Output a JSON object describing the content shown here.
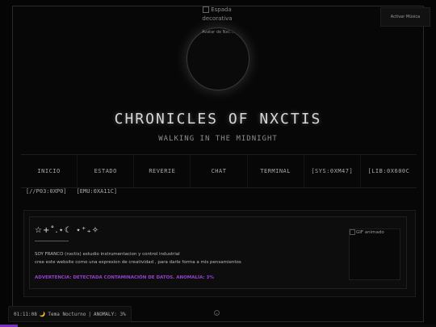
{
  "header": {
    "decorative_image_alt": "Espada decorativa",
    "music_button": "Activar Música",
    "avatar_alt": "Avatar de Nxc...",
    "title": "CHRONICLES OF NXCTIS",
    "subtitle": "WALKING IN THE MIDNIGHT"
  },
  "nav": {
    "items": [
      {
        "label": "INICIO"
      },
      {
        "label": "ESTADO"
      },
      {
        "label": "REVERIE"
      },
      {
        "label": "CHAT"
      },
      {
        "label": "TERMINAL"
      },
      {
        "label": "[SYS:0XM47]"
      },
      {
        "label": "[LIB:0X600C"
      }
    ],
    "row2": [
      {
        "label": "[//P03:0XP0]"
      },
      {
        "label": "[EMU:0XA11C]"
      }
    ]
  },
  "profile": {
    "sparkles": "☆+˚.⋆☾ ⋆⁺₊✧",
    "bio_line1": "SOY FRANCO (nxctis) estudio instrumentacion y control industrial",
    "bio_line2": "cree este website como una expresion de creatividad , para darle forma a mis pensamientos",
    "warning": "ADVERTENCIA: DETECTADA CONTAMINACIÓN DE DATOS. ANOMALÍA: 3%",
    "gif_alt": "GIF animado"
  },
  "statusbar": {
    "time": "01:11:08",
    "moon": "🌙",
    "theme": "Tema Nocturno",
    "sep": "|",
    "anomaly": "ANOMALY: 3%"
  },
  "progress": {
    "value_percent": 4
  },
  "colors": {
    "accent": "#9b3fd6",
    "background": "#050505"
  },
  "icons": {
    "scroll": "scroll-down-icon"
  }
}
